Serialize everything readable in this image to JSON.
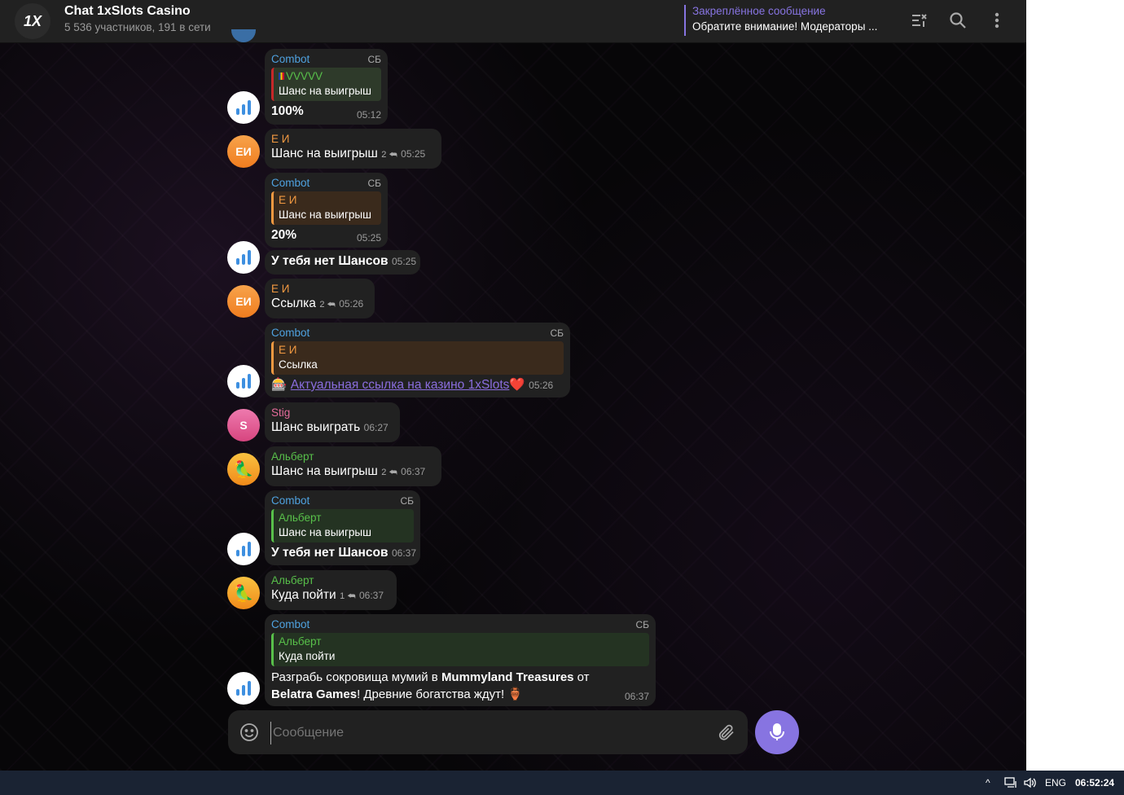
{
  "header": {
    "logo_text": "1X",
    "chat_title": "Chat 1xSlots Casino",
    "chat_subtitle": "5 536 участников, 191 в сети",
    "pinned_label": "Закреплённое сообщение",
    "pinned_text": "Обратите внимание! Модераторы ..."
  },
  "messages": [
    {
      "sender": "Combot",
      "badge": "СБ",
      "reply_sender": "VVVVV",
      "reply_text": "Шанс на выигрыш",
      "text": "100%",
      "time": "05:12"
    },
    {
      "sender": "Е И",
      "avatar": "ЕИ",
      "text": "Шанс на выигрыш",
      "replies": "2",
      "time": "05:25"
    },
    {
      "sender": "Combot",
      "badge": "СБ",
      "reply_sender": "Е И",
      "reply_text": "Шанс на выигрыш",
      "text": "20%",
      "time": "05:25"
    },
    {
      "text": "У тебя нет Шансов",
      "time": "05:25"
    },
    {
      "sender": "Е И",
      "avatar": "ЕИ",
      "text": "Ссылка",
      "replies": "2",
      "time": "05:26"
    },
    {
      "sender": "Combot",
      "badge": "СБ",
      "reply_sender": "Е И",
      "reply_text": "Ссылка",
      "emoji": "🎰",
      "link": "Актуальная ссылка на казино 1xSlots",
      "heart": "❤️",
      "time": "05:26"
    },
    {
      "sender": "Stig",
      "avatar": "S",
      "text": "Шанс выиграть",
      "time": "06:27"
    },
    {
      "sender": "Альберт",
      "text": "Шанс на выигрыш",
      "replies": "2",
      "time": "06:37"
    },
    {
      "sender": "Combot",
      "badge": "СБ",
      "reply_sender": "Альберт",
      "reply_text": "Шанс на выигрыш",
      "text": "У тебя нет Шансов",
      "time": "06:37"
    },
    {
      "sender": "Альберт",
      "text": "Куда пойти",
      "replies": "1",
      "time": "06:37"
    },
    {
      "sender": "Combot",
      "badge": "СБ",
      "reply_sender": "Альберт",
      "reply_text": "Куда пойти",
      "text_line1_a": "Разграбь сокровища мумий в ",
      "text_line1_b": "Mummyland Treasures",
      "text_line1_c": " от",
      "text_line2_a": "Belatra Games",
      "text_line2_b": "! Древние богатства ждут! ",
      "text_emoji": "🏺",
      "time": "06:37"
    }
  ],
  "composer": {
    "placeholder": "Сообщение"
  },
  "taskbar": {
    "lang": "ENG",
    "clock": "06:52:24"
  },
  "colors": {
    "accent": "#8774e1",
    "bubble": "#212121",
    "link": "#8a6dde"
  }
}
